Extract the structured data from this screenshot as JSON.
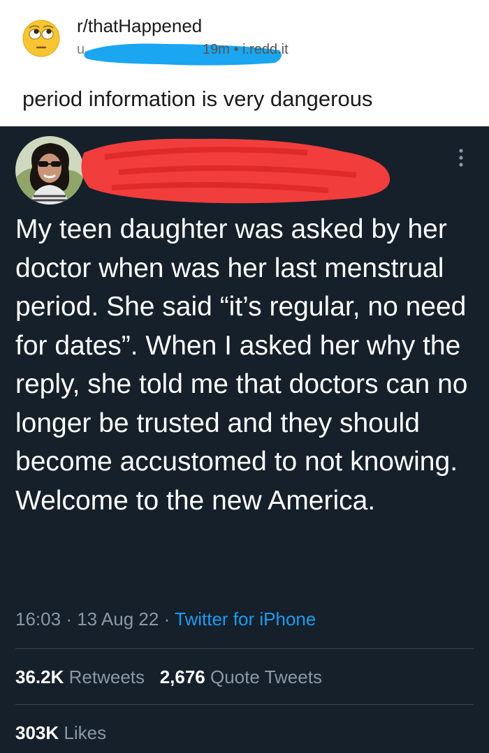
{
  "reddit": {
    "subreddit": "r/thatHappened",
    "user_prefix": "u",
    "time": "19m",
    "separator": "•",
    "domain": "i.redd.it",
    "title": "period information is very dangerous"
  },
  "tweet": {
    "text": "My teen daughter was asked by her doctor when was her last menstrual period. She said “it’s regular, no need for dates”. When I asked her why the reply, she told me that doctors can no longer be trusted and they should become accustomed to not knowing. Welcome to the new America.",
    "time": "16:03",
    "date": "13 Aug 22",
    "dot": "·",
    "source": "Twitter for iPhone",
    "retweets_count": "36.2K",
    "retweets_label": "Retweets",
    "quote_count": "2,676",
    "quote_label": "Quote Tweets",
    "likes_count": "303K",
    "likes_label": "Likes"
  },
  "icons": {
    "subreddit": "rolling-eyes-emoji-icon",
    "more": "vertical-ellipsis-icon",
    "user_redaction": "blue-scribble",
    "name_redaction": "red-scribble"
  },
  "colors": {
    "tweet_bg": "#15202b",
    "link_blue": "#1d9bf0",
    "redaction_blue": "#1aa6f0",
    "redaction_red": "#f23d3d"
  }
}
